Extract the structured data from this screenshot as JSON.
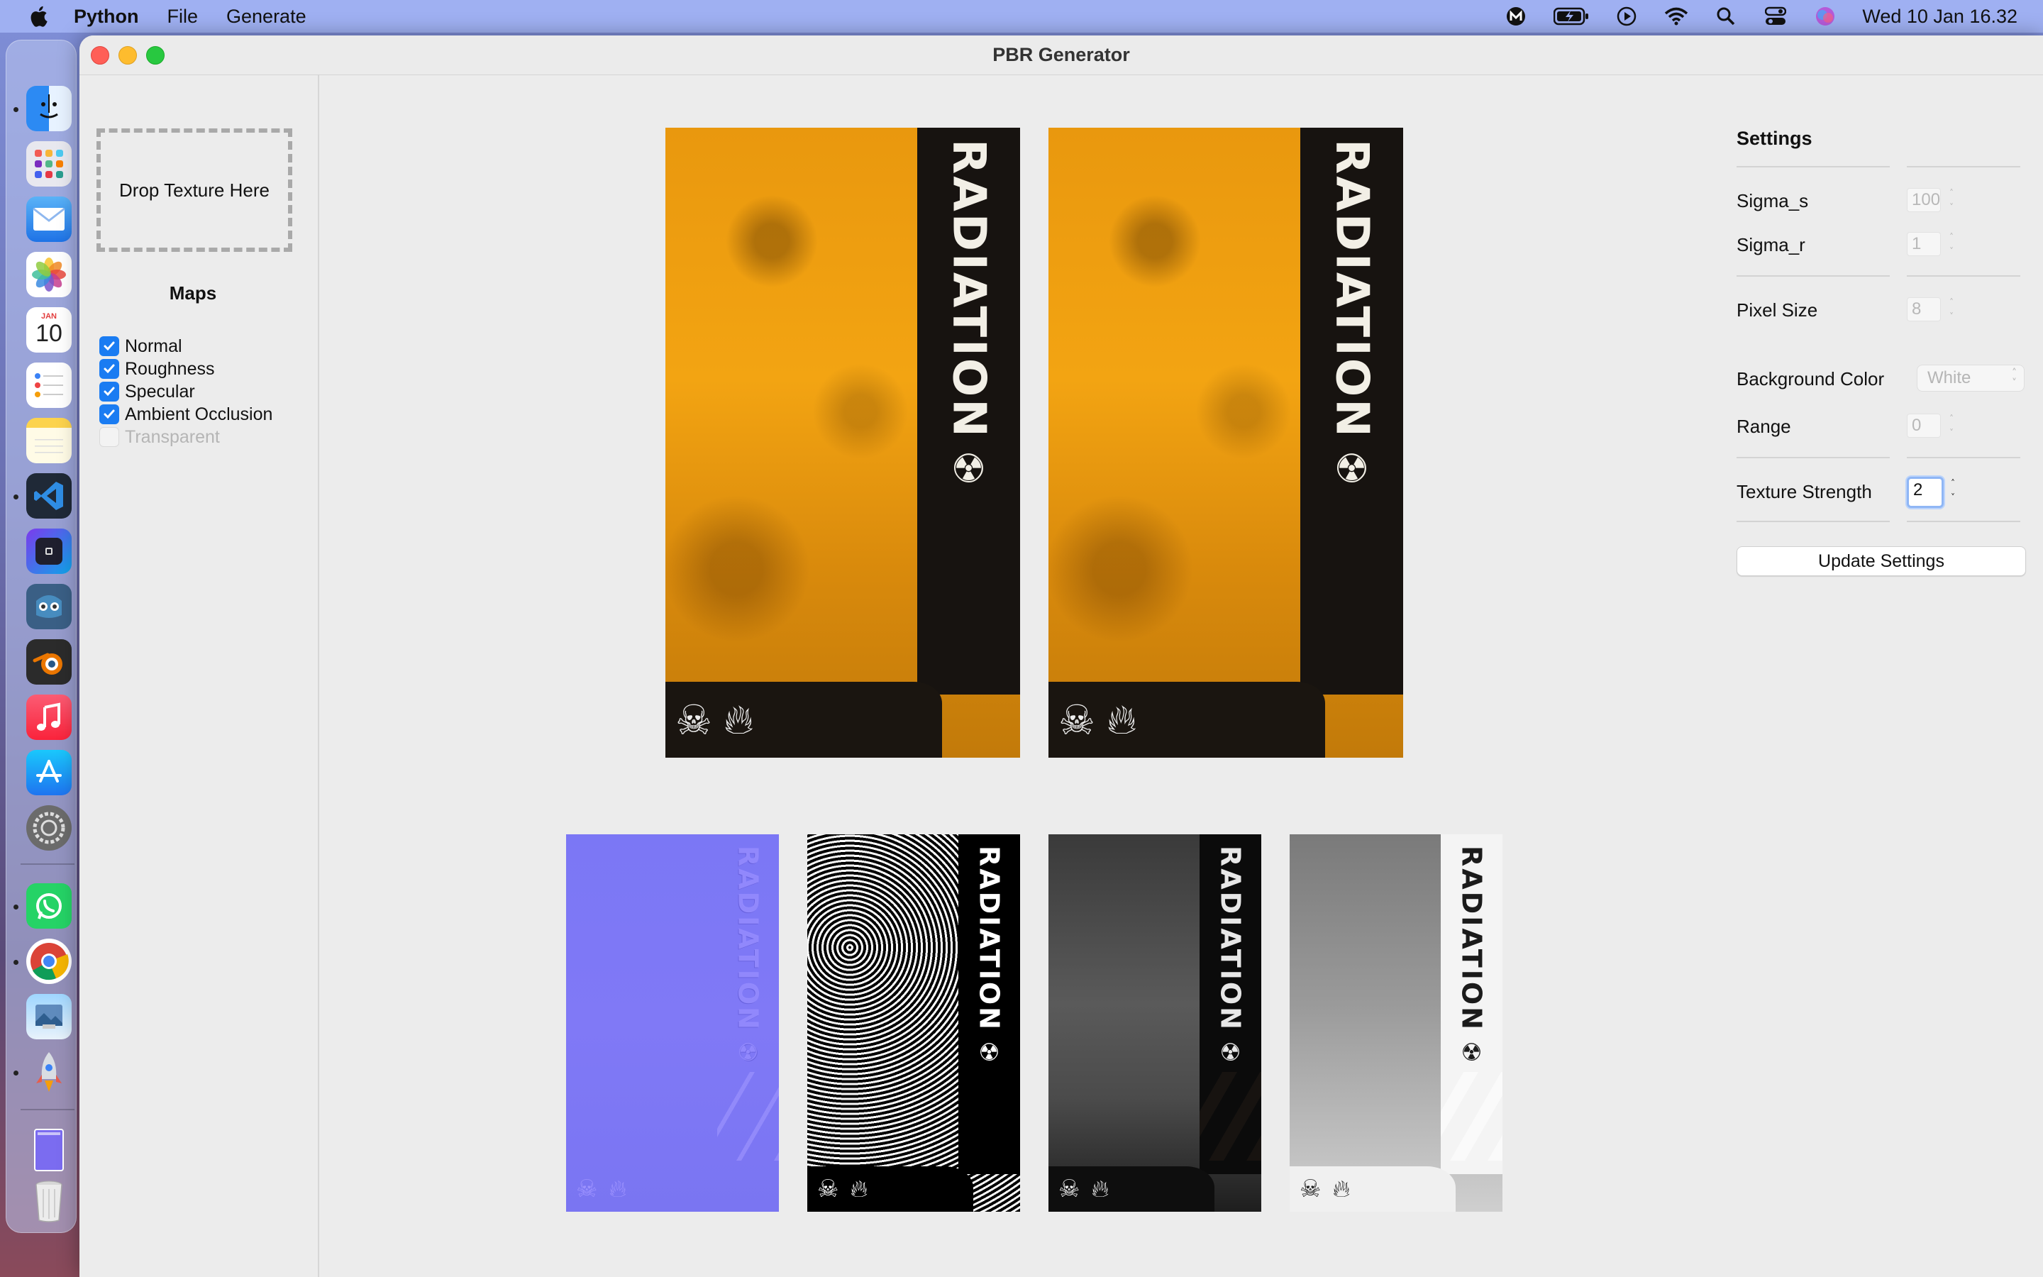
{
  "menubar": {
    "app_name": "Python",
    "menus": [
      "File",
      "Generate"
    ],
    "clock": "Wed 10 Jan  16.32",
    "status_icons": [
      "malwarebytes-icon",
      "battery-icon",
      "play-icon",
      "wifi-icon",
      "search-icon",
      "control-center-icon",
      "siri-icon"
    ]
  },
  "dock": {
    "apps": [
      "finder",
      "launchpad",
      "mail",
      "photos",
      "calendar",
      "reminders",
      "notes",
      "vscode",
      "xcode-instruments",
      "godot",
      "blender",
      "music",
      "app-store",
      "system-settings",
      "whatsapp",
      "chrome",
      "preview",
      "rocket",
      "downloads",
      "trash"
    ],
    "calendar_month": "JAN",
    "calendar_day": "10"
  },
  "window": {
    "title": "PBR Generator"
  },
  "left_panel": {
    "drop_zone_label": "Drop Texture Here",
    "maps_title": "Maps",
    "maps": [
      {
        "label": "Normal",
        "checked": true,
        "enabled": true
      },
      {
        "label": "Roughness",
        "checked": true,
        "enabled": true
      },
      {
        "label": "Specular",
        "checked": true,
        "enabled": true
      },
      {
        "label": "Ambient Occlusion",
        "checked": true,
        "enabled": true
      },
      {
        "label": "Transparent",
        "checked": false,
        "enabled": false
      }
    ]
  },
  "previews": {
    "texture_text": "RADIATION",
    "images": [
      "original",
      "processed",
      "normal-map",
      "roughness-map",
      "specular-map",
      "ambient-occlusion-map"
    ]
  },
  "settings": {
    "title": "Settings",
    "sigma_s": {
      "label": "Sigma_s",
      "value": "100"
    },
    "sigma_r": {
      "label": "Sigma_r",
      "value": "1"
    },
    "pixel_size": {
      "label": "Pixel Size",
      "value": "8"
    },
    "background_color": {
      "label": "Background Color",
      "value": "White"
    },
    "range": {
      "label": "Range",
      "value": "0"
    },
    "texture_strength": {
      "label": "Texture Strength",
      "value": "2"
    },
    "update_button": "Update Settings"
  },
  "colors": {
    "menubar": "#9fb0f2",
    "window_bg": "#ececec",
    "checkbox_accent": "#1a7cf2",
    "texture_orange": "#f3a412",
    "normal_map": "#7b77f5"
  }
}
